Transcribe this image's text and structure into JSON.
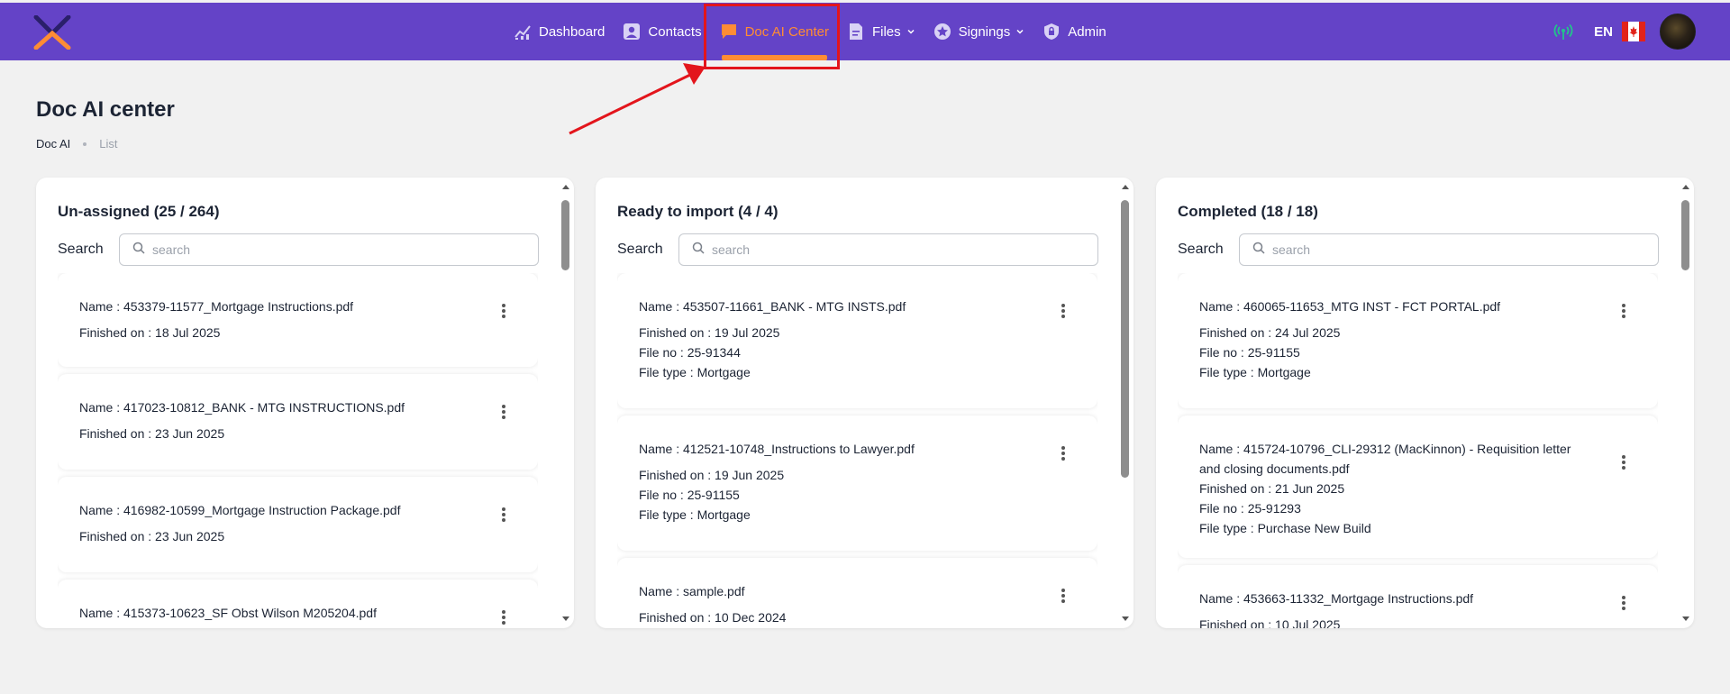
{
  "nav": {
    "items": [
      {
        "label": "Dashboard",
        "icon": "chart-line-icon",
        "has_dropdown": false,
        "active": false
      },
      {
        "label": "Contacts",
        "icon": "contact-card-icon",
        "has_dropdown": false,
        "active": false
      },
      {
        "label": "Doc AI Center",
        "icon": "chat-bubble-icon",
        "has_dropdown": false,
        "active": true
      },
      {
        "label": "Files",
        "icon": "document-icon",
        "has_dropdown": true,
        "active": false
      },
      {
        "label": "Signings",
        "icon": "star-badge-icon",
        "has_dropdown": true,
        "active": false
      },
      {
        "label": "Admin",
        "icon": "lock-icon",
        "has_dropdown": false,
        "active": false
      }
    ],
    "lang": "EN",
    "colors": {
      "bar": "#6443c7",
      "active": "#ff8c34",
      "signal": "#22c58b",
      "annotation": "#e3151c"
    }
  },
  "page": {
    "title": "Doc AI center",
    "breadcrumb": [
      "Doc AI",
      "List"
    ]
  },
  "columns": [
    {
      "title": "Un-assigned (25 / 264)",
      "search_label": "Search",
      "search_placeholder": "search",
      "cards": [
        {
          "lines": [
            "Name : 453379-11577_Mortgage Instructions.pdf",
            "Finished on : 18 Jul 2025"
          ]
        },
        {
          "lines": [
            "Name : 417023-10812_BANK - MTG INSTRUCTIONS.pdf",
            "Finished on : 23 Jun 2025"
          ]
        },
        {
          "lines": [
            "Name : 416982-10599_Mortgage Instruction Package.pdf",
            "Finished on : 23 Jun 2025"
          ]
        },
        {
          "lines": [
            "Name : 415373-10623_SF Obst Wilson M205204.pdf"
          ]
        }
      ]
    },
    {
      "title": "Ready to import (4 / 4)",
      "search_label": "Search",
      "search_placeholder": "search",
      "cards": [
        {
          "lines": [
            "Name : 453507-11661_BANK - MTG INSTS.pdf",
            "Finished on : 19 Jul 2025",
            "File no : 25-91344",
            "File type : Mortgage"
          ]
        },
        {
          "lines": [
            "Name : 412521-10748_Instructions to Lawyer.pdf",
            "Finished on : 19 Jun 2025",
            "File no : 25-91155",
            "File type : Mortgage"
          ]
        },
        {
          "lines": [
            "Name : sample.pdf",
            "Finished on : 10 Dec 2024"
          ]
        }
      ]
    },
    {
      "title": "Completed (18 / 18)",
      "search_label": "Search",
      "search_placeholder": "search",
      "cards": [
        {
          "lines": [
            "Name : 460065-11653_MTG INST - FCT PORTAL.pdf",
            "Finished on : 24 Jul 2025",
            "File no : 25-91155",
            "File type : Mortgage"
          ]
        },
        {
          "lines": [
            "Name : 415724-10796_CLI-29312 (MacKinnon) - Requisition letter",
            "and closing documents.pdf",
            "Finished on : 21 Jun 2025",
            "File no : 25-91293",
            "File type : Purchase New Build"
          ]
        },
        {
          "lines": [
            "Name : 453663-11332_Mortgage Instructions.pdf",
            "Finished on : 10 Jul 2025"
          ]
        }
      ]
    }
  ]
}
